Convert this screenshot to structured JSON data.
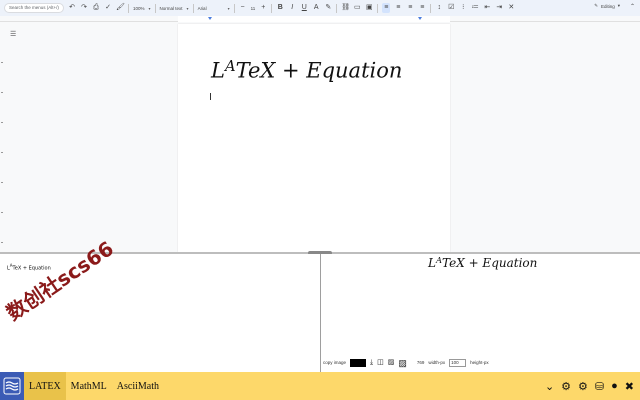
{
  "toolbar": {
    "search_placeholder": "Search the menus (Alt+/)",
    "zoom": "100%",
    "style": "Normal text",
    "font": "Arial",
    "font_size": "11",
    "mode": "Editing",
    "icons": [
      "undo-icon",
      "redo-icon",
      "print-icon",
      "spellcheck-icon",
      "paint-format-icon",
      "bold-icon",
      "italic-icon",
      "underline-icon",
      "text-color-icon",
      "highlight-icon",
      "link-icon",
      "comment-icon",
      "image-icon",
      "align-left-icon",
      "align-center-icon",
      "align-right-icon",
      "justify-icon",
      "line-spacing-icon",
      "checklist-icon",
      "bulleted-list-icon",
      "numbered-list-icon",
      "decrease-indent-icon",
      "increase-indent-icon",
      "clear-formatting-icon"
    ]
  },
  "document": {
    "equation_base": "L",
    "equation_sup": "A",
    "equation_rest": "TeX + Equation"
  },
  "editor": {
    "source_base": "L",
    "source_sup": "A",
    "source_rest": "TeX + Equation",
    "watermark": "数创社scs66"
  },
  "output": {
    "equation_base": "L",
    "equation_sup": "A",
    "equation_rest": "TeX + Equation",
    "copy_image_label": "copy image",
    "color": "#000000",
    "width_value": "769",
    "width_unit": "width-px",
    "height_value": "100",
    "height_unit": "height-px"
  },
  "bottombar": {
    "tabs": [
      {
        "label": "LATEX",
        "active": true
      },
      {
        "label": "MathML",
        "active": false
      },
      {
        "label": "AsciiMath",
        "active": false
      }
    ],
    "right_icons": [
      "chevron-down-icon",
      "settings-icon",
      "gears-icon",
      "database-icon",
      "github-icon",
      "close-icon"
    ]
  },
  "colors": {
    "accent": "#fdd86a",
    "tab_active": "#e9c24a",
    "logo_bg": "#3b5bb5",
    "watermark": "#8b1a1a"
  }
}
